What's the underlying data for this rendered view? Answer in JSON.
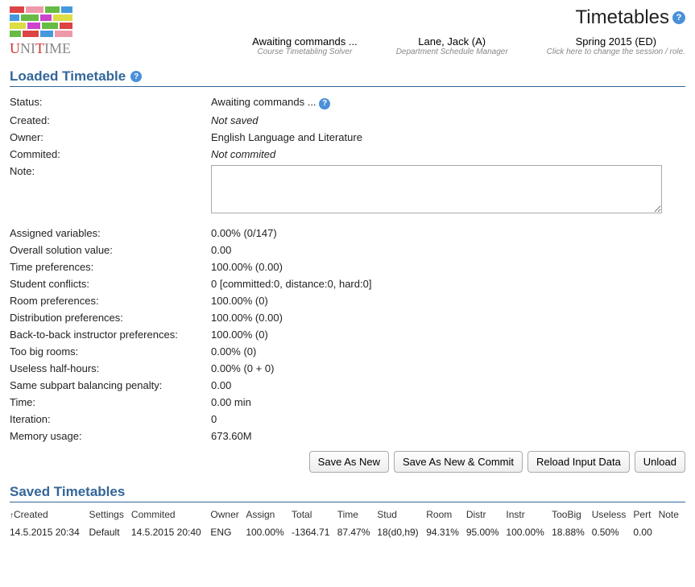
{
  "header": {
    "page_title": "Timetables",
    "meta": [
      {
        "top": "Awaiting commands ...",
        "bottom": "Course Timetabling Solver"
      },
      {
        "top": "Lane, Jack (A)",
        "bottom": "Department Schedule Manager"
      },
      {
        "top": "Spring 2015 (ED)",
        "bottom": "Click here to change the session / role."
      }
    ]
  },
  "loaded": {
    "section_title": "Loaded Timetable",
    "labels": {
      "status": "Status:",
      "created": "Created:",
      "owner": "Owner:",
      "commited": "Commited:",
      "note": "Note:",
      "assigned_variables": "Assigned variables:",
      "overall_solution_value": "Overall solution value:",
      "time_preferences": "Time preferences:",
      "student_conflicts": "Student conflicts:",
      "room_preferences": "Room preferences:",
      "distribution_preferences": "Distribution preferences:",
      "back_to_back": "Back-to-back instructor preferences:",
      "too_big_rooms": "Too big rooms:",
      "useless_half_hours": "Useless half-hours:",
      "same_subpart": "Same subpart balancing penalty:",
      "time": "Time:",
      "iteration": "Iteration:",
      "memory_usage": "Memory usage:"
    },
    "values": {
      "status": "Awaiting commands ...",
      "created": "Not saved",
      "owner": "English Language and Literature",
      "commited": "Not commited",
      "note": "",
      "assigned_variables": "0.00% (0/147)",
      "overall_solution_value": "0.00",
      "time_preferences": "100.00% (0.00)",
      "student_conflicts": "0 [committed:0, distance:0, hard:0]",
      "room_preferences": "100.00% (0)",
      "distribution_preferences": "100.00% (0.00)",
      "back_to_back": "100.00% (0)",
      "too_big_rooms": "0.00% (0)",
      "useless_half_hours": "0.00% (0 + 0)",
      "same_subpart": "0.00",
      "time": "0.00 min",
      "iteration": "0",
      "memory_usage": "673.60M"
    }
  },
  "buttons": {
    "save_as_new": "Save As New",
    "save_as_new_commit": "Save As New & Commit",
    "reload_input_data": "Reload Input Data",
    "unload": "Unload"
  },
  "saved": {
    "section_title": "Saved Timetables",
    "columns": {
      "created": "Created",
      "settings": "Settings",
      "commited": "Commited",
      "owner": "Owner",
      "assign": "Assign",
      "total": "Total",
      "time": "Time",
      "stud": "Stud",
      "room": "Room",
      "distr": "Distr",
      "instr": "Instr",
      "toobig": "TooBig",
      "useless": "Useless",
      "pert": "Pert",
      "note": "Note"
    },
    "sort_indicator": "↑",
    "rows": [
      {
        "created": "14.5.2015 20:34",
        "settings": "Default",
        "commited": "14.5.2015 20:40",
        "owner": "ENG",
        "assign": "100.00%",
        "total": "-1364.71",
        "time": "87.47%",
        "stud": "18(d0,h9)",
        "room": "94.31%",
        "distr": "95.00%",
        "instr": "100.00%",
        "toobig": "18.88%",
        "useless": "0.50%",
        "pert": "0.00",
        "note": ""
      }
    ]
  }
}
